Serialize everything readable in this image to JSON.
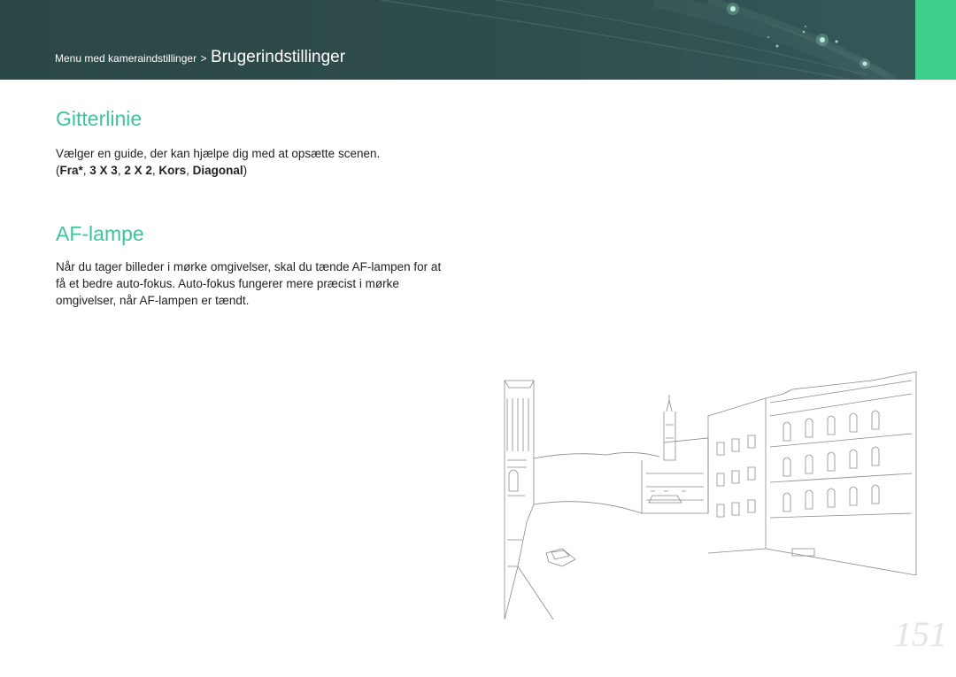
{
  "header": {
    "breadcrumb_parent": "Menu med kameraindstillinger",
    "breadcrumb_separator": ">",
    "breadcrumb_current": "Brugerindstillinger"
  },
  "sections": [
    {
      "title": "Gitterlinie",
      "description": "Vælger en guide, der kan hjælpe dig med at opsætte scenen.",
      "options": {
        "open": "(",
        "items": [
          "Fra*",
          "3 X 3",
          "2 X 2",
          "Kors",
          "Diagonal"
        ],
        "separator": ", ",
        "close": ")"
      }
    },
    {
      "title": "AF-lampe",
      "description": "Når du tager billeder i mørke omgivelser, skal du tænde AF-lampen for at få et bedre auto-fokus. Auto-fokus fungerer mere præcist i mørke omgivelser, når AF-lampen er tændt."
    }
  ],
  "page_number": "151",
  "colors": {
    "header_bg": "#2f4d4c",
    "accent": "#3ecf8e",
    "title": "#3ec3a0"
  },
  "icons": [
    "city-canal-illustration"
  ]
}
